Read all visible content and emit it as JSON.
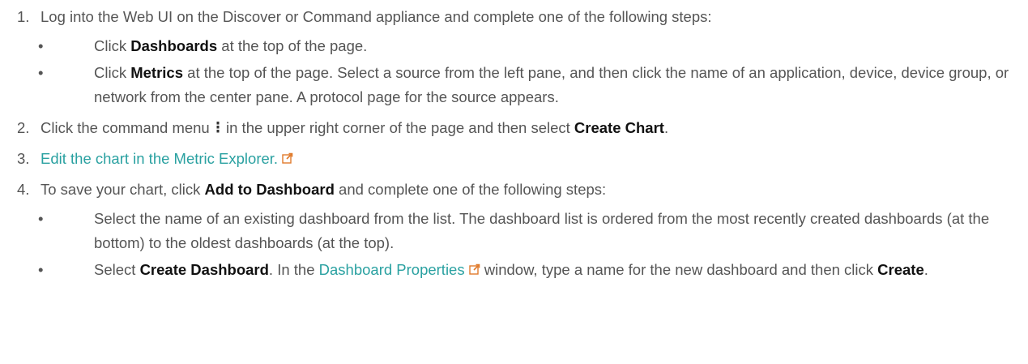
{
  "steps": [
    {
      "num": "1.",
      "text": "Log into the Web UI on the Discover or Command appliance and complete one of the following steps:",
      "substeps": [
        {
          "bullet": "•",
          "b1": "Dashboards",
          "t1": " at the top of the page.",
          "pre": "Click "
        },
        {
          "bullet": "•",
          "pre": "Click ",
          "b1": "Metrics",
          "t1": " at the top of the page. Select a source from the left pane, and then click the name of an application, device, device group, or network from the center pane. A protocol page for the source appears."
        }
      ]
    },
    {
      "num": "2.",
      "pre": "Click the command menu",
      "mid": "in the upper right corner of the page and then select ",
      "b1": "Create Chart",
      "post": "."
    },
    {
      "num": "3.",
      "link": "Edit the chart in the Metric Explorer."
    },
    {
      "num": "4.",
      "pre": "To save your chart, click ",
      "b1": "Add to Dashboard",
      "post": " and complete one of the following steps:",
      "substeps": [
        {
          "bullet": "•",
          "text": "Select the name of an existing dashboard from the list. The dashboard list is ordered from the most recently created dashboards (at the bottom) to the oldest dashboards (at the top)."
        },
        {
          "bullet": "•",
          "pre": "Select ",
          "b1": "Create Dashboard",
          "t1": ". In the ",
          "link": "Dashboard Properties",
          "t2": " window, type a name for the new dashboard and then click ",
          "b2": "Create",
          "post": "."
        }
      ]
    }
  ],
  "colors": {
    "text": "#555555",
    "bold": "#111111",
    "link": "#2aa1a1"
  },
  "icons": {
    "external": "external-link-icon",
    "command_menu": "vertical-ellipsis-icon"
  }
}
